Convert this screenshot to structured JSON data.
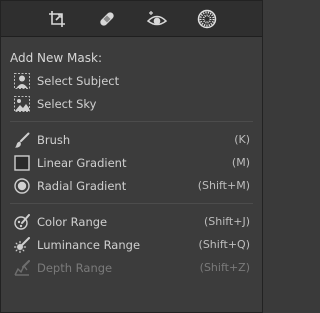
{
  "toolbar": {
    "tools": [
      {
        "icon": "crop-icon"
      },
      {
        "icon": "healing-bandage-icon"
      },
      {
        "icon": "red-eye-icon"
      },
      {
        "icon": "masking-icon"
      }
    ]
  },
  "menu": {
    "title": "Add New Mask:",
    "ai_items": [
      {
        "label": "Select Subject",
        "icon": "select-subject-icon"
      },
      {
        "label": "Select Sky",
        "icon": "select-sky-icon"
      }
    ],
    "tool_items": [
      {
        "label": "Brush",
        "shortcut": "(K)",
        "icon": "brush-icon"
      },
      {
        "label": "Linear Gradient",
        "shortcut": "(M)",
        "icon": "linear-gradient-icon"
      },
      {
        "label": "Radial Gradient",
        "shortcut": "(Shift+M)",
        "icon": "radial-gradient-icon"
      }
    ],
    "range_items": [
      {
        "label": "Color Range",
        "shortcut": "(Shift+J)",
        "icon": "color-range-icon"
      },
      {
        "label": "Luminance Range",
        "shortcut": "(Shift+Q)",
        "icon": "luminance-range-icon"
      },
      {
        "label": "Depth Range",
        "shortcut": "(Shift+Z)",
        "icon": "depth-range-icon",
        "disabled": true
      }
    ]
  },
  "colors": {
    "background": "#3c3c3c",
    "toolbar": "#2f2f2f",
    "text": "#d0d0d0",
    "disabled_text": "#7a7a7a"
  }
}
